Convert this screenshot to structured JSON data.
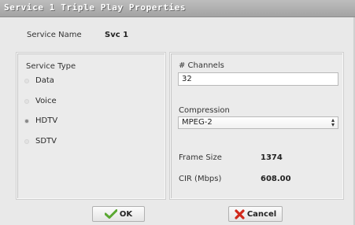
{
  "window": {
    "title": "Service 1 Triple Play Properties"
  },
  "service_name": {
    "label": "Service Name",
    "value": "Svc 1"
  },
  "service_type": {
    "label": "Service Type",
    "options": [
      "Data",
      "Voice",
      "HDTV",
      "SDTV"
    ],
    "selected": "HDTV"
  },
  "channels": {
    "label": "# Channels",
    "value": "32"
  },
  "compression": {
    "label": "Compression",
    "value": "MPEG-2"
  },
  "frame_size": {
    "label": "Frame Size",
    "value": "1374"
  },
  "cir": {
    "label": "CIR (Mbps)",
    "value": "608.00"
  },
  "buttons": {
    "ok": "OK",
    "cancel": "Cancel"
  },
  "icons": {
    "ok": "checkmark-icon",
    "cancel": "x-icon",
    "select": "up-down-arrows-icon"
  },
  "colors": {
    "ok_icon": "#5aa832",
    "cancel_icon": "#d12a1c",
    "titlebar": "#b0b0b0"
  }
}
